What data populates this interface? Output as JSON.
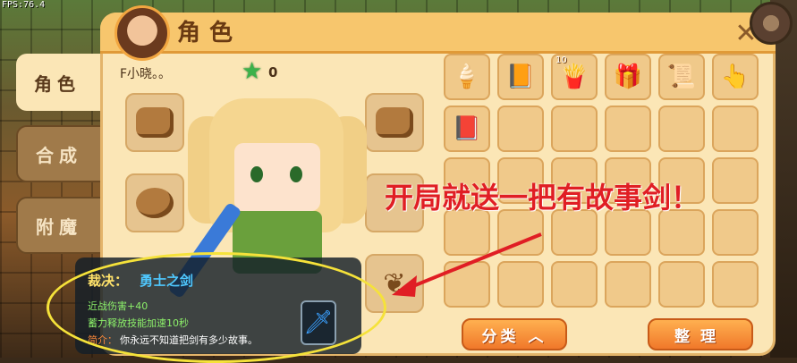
{
  "fps": "FPS:76.4",
  "header": {
    "title": "角色"
  },
  "tabs": [
    {
      "label": "角色",
      "active": true
    },
    {
      "label": "合成",
      "active": false
    },
    {
      "label": "附魔",
      "active": false
    }
  ],
  "player": {
    "name": "F小晓。。",
    "stars": "0"
  },
  "inventory": {
    "slots": [
      {
        "icon": "ice-cream-icon",
        "glyph": "🍦",
        "badge": ""
      },
      {
        "icon": "book-flag-icon",
        "glyph": "📙",
        "badge": ""
      },
      {
        "icon": "fries-icon",
        "glyph": "🍟",
        "badge": "10"
      },
      {
        "icon": "gift-box-icon",
        "glyph": "🎁",
        "badge": ""
      },
      {
        "icon": "scroll-icon",
        "glyph": "📜",
        "badge": ""
      },
      {
        "icon": "cursor-hand-icon",
        "glyph": "👆",
        "badge": ""
      },
      {
        "icon": "book-icon",
        "glyph": "📕",
        "badge": ""
      }
    ],
    "empty_count": 23
  },
  "annotation": "开局就送一把有故事剑！",
  "tooltip": {
    "name_label": "裁决：",
    "name": "勇士之剑",
    "lines": [
      "近战伤害+40",
      "蓄力释放技能加速10秒"
    ],
    "desc_label": "简介：",
    "desc": "你永远不知道把剑有多少故事。"
  },
  "buttons": {
    "classify": "分类 ︿",
    "sort": "整理"
  },
  "colors": {
    "panel": "#fbe6b6",
    "header": "#f7c66d",
    "button": "#f0782a",
    "annotation": "#e01e24"
  }
}
